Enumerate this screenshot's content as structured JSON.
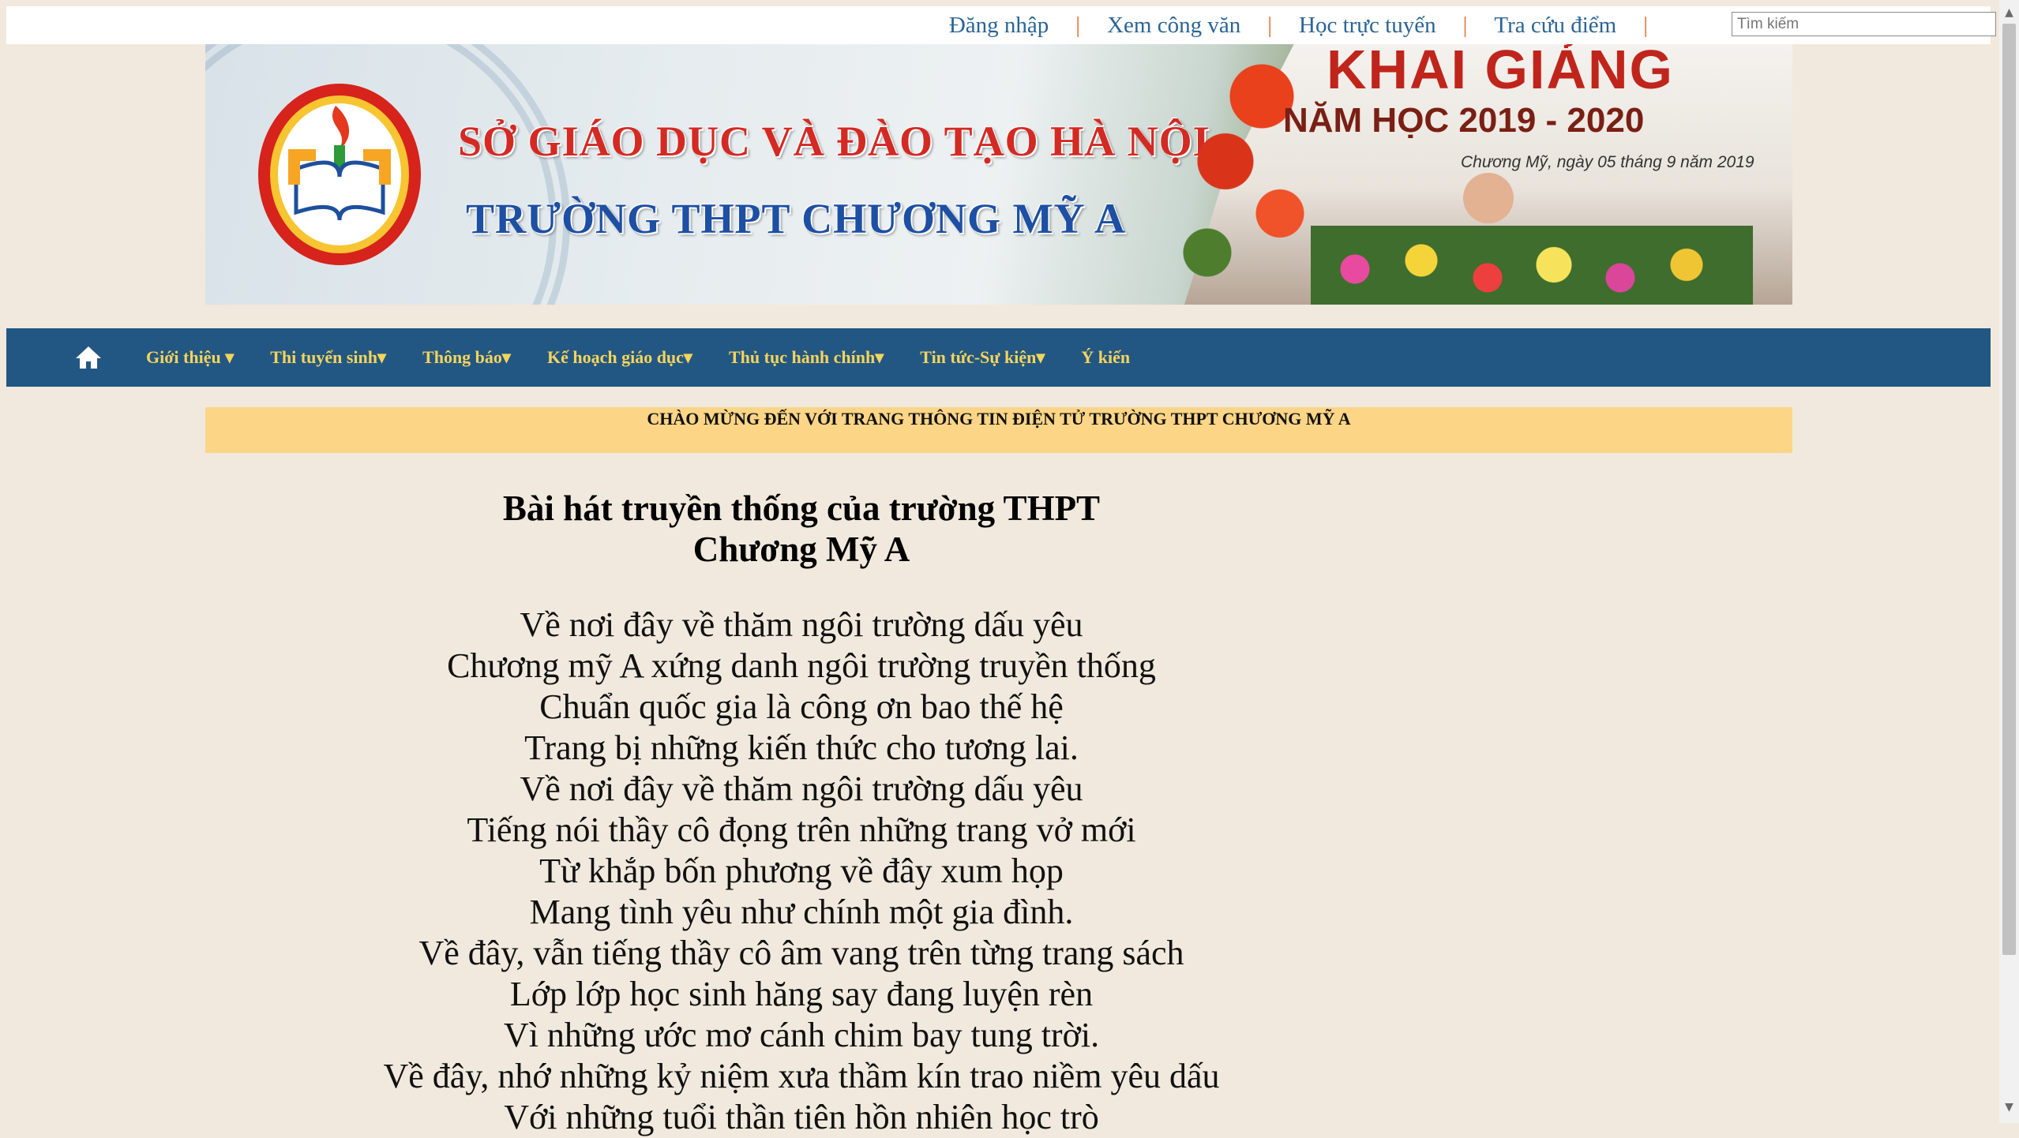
{
  "topbar": {
    "links": [
      "Đăng nhập",
      "Xem công văn",
      "Học trực tuyến",
      "Tra cứu điểm"
    ],
    "separator": "|",
    "search_placeholder": "Tìm kiếm"
  },
  "banner": {
    "line1": "SỞ GIÁO DỤC VÀ ĐÀO TẠO HÀ NỘI",
    "line2": "TRƯỜNG THPT CHƯƠNG MỸ A",
    "event_title": "KHAI GIẢNG",
    "school_year": "NĂM HỌC 2019 - 2020",
    "event_date": "Chương Mỹ, ngày 05 tháng 9 năm 2019"
  },
  "nav": {
    "items": [
      {
        "label": "Giới thiệu ▾"
      },
      {
        "label": "Thi tuyển sinh▾"
      },
      {
        "label": "Thông báo▾"
      },
      {
        "label": "Kế hoạch giáo dục▾"
      },
      {
        "label": "Thủ tục hành chính▾"
      },
      {
        "label": "Tin tức-Sự kiện▾"
      },
      {
        "label": "Ý kiến"
      }
    ]
  },
  "welcome": "CHÀO MỪNG ĐẾN VỚI TRANG THÔNG TIN ĐIỆN TỬ TRƯỜNG THPT CHƯƠNG MỸ A",
  "article": {
    "title_line1": "Bài hát truyền thống của trường THPT",
    "title_line2": "Chương Mỹ A",
    "lyrics": [
      "Về nơi đây về thăm ngôi trường dấu yêu",
      "Chương mỹ A xứng danh ngôi trường truyền thống",
      "Chuẩn quốc gia là công ơn bao thế hệ",
      "Trang bị những kiến thức cho tương lai.",
      "Về nơi đây về thăm ngôi trường dấu yêu",
      "Tiếng nói thầy cô đọng trên những trang vở mới",
      "Từ khắp bốn phương về đây xum họp",
      "Mang tình yêu như chính một gia đình.",
      "Về đây, vẫn tiếng thầy cô âm vang trên từng trang sách",
      "Lớp lớp học sinh hăng say đang luyện rèn",
      "Vì những ước mơ cánh chim bay tung trời.",
      "Về đây, nhớ những kỷ niệm xưa thầm kín trao niềm yêu dấu",
      "Với những tuổi thần tiên hồn nhiên học trò"
    ]
  },
  "colors": {
    "page_bg": "#f1e9dd",
    "nav_bg": "#235783",
    "nav_text": "#f5d45a",
    "welcome_bg": "#fdd587",
    "link": "#2a6496",
    "separator": "#e06b2e"
  }
}
